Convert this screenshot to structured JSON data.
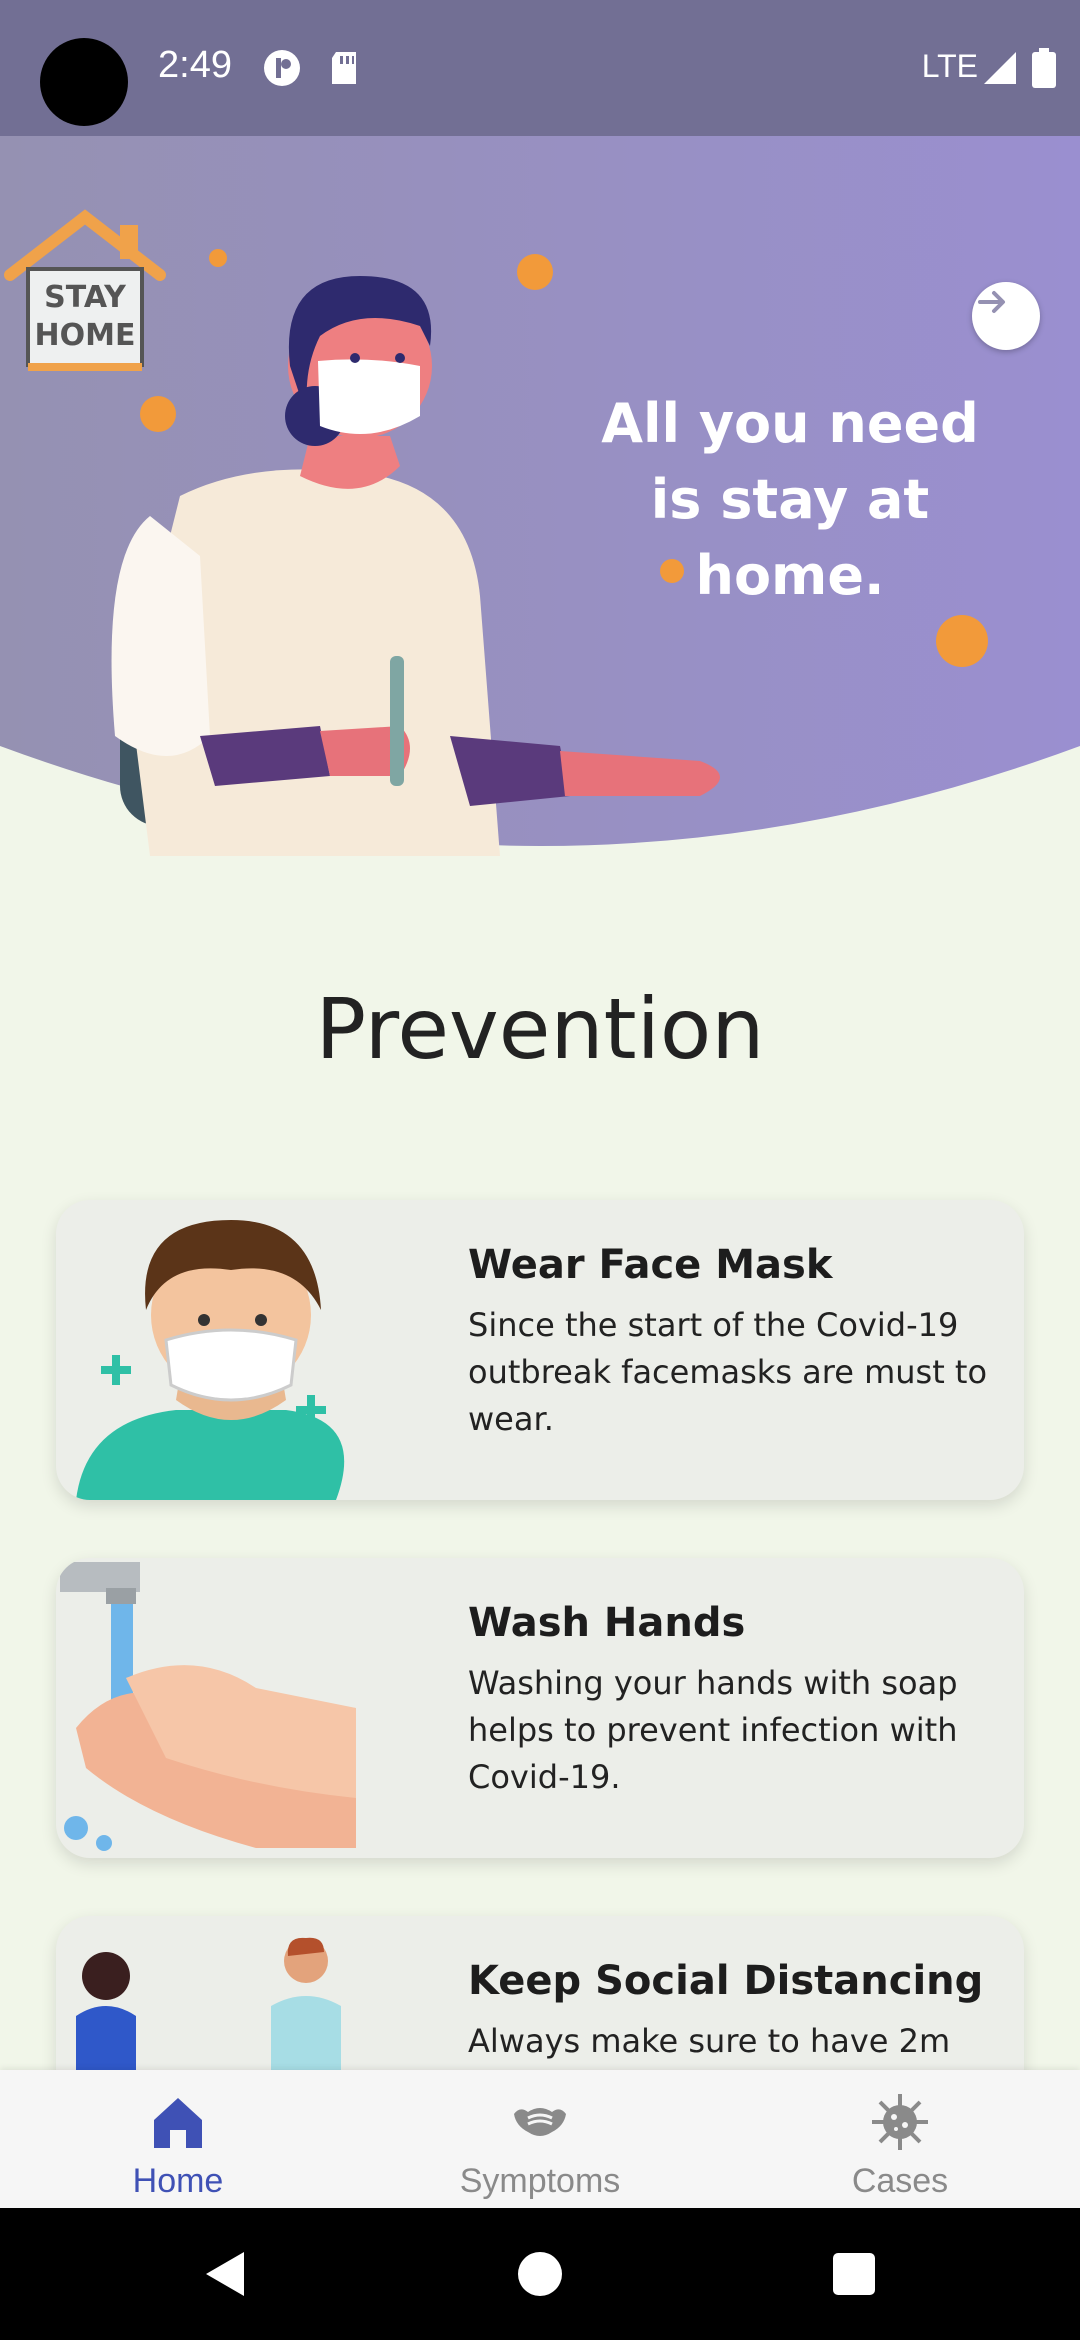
{
  "status_bar": {
    "time": "2:49",
    "network": "LTE"
  },
  "hero": {
    "logo_text_line1": "STAY",
    "logo_text_line2": "HOME",
    "tagline_line1": "All you need",
    "tagline_line2": "is stay at home.",
    "next_icon": "arrow-right-icon"
  },
  "section": {
    "title": "Prevention"
  },
  "cards": [
    {
      "title": "Wear Face Mask",
      "description": "Since the start of the Covid-19 outbreak facemasks are must to wear."
    },
    {
      "title": "Wash Hands",
      "description": "Washing your hands with soap helps to prevent infection with Covid-19."
    },
    {
      "title": "Keep Social Distancing",
      "description": "Always make sure to have 2m"
    }
  ],
  "bottom_nav": {
    "items": [
      {
        "label": "Home",
        "icon": "home-icon",
        "active": true
      },
      {
        "label": "Symptoms",
        "icon": "mask-icon",
        "active": false
      },
      {
        "label": "Cases",
        "icon": "virus-icon",
        "active": false
      }
    ],
    "active_color": "#3f51b5",
    "inactive_color": "#8a8a8a"
  },
  "colors": {
    "hero_start": "#9591b2",
    "hero_end": "#9a8fd0",
    "status_bar": "#726f94",
    "background": "#f1f6e9"
  }
}
